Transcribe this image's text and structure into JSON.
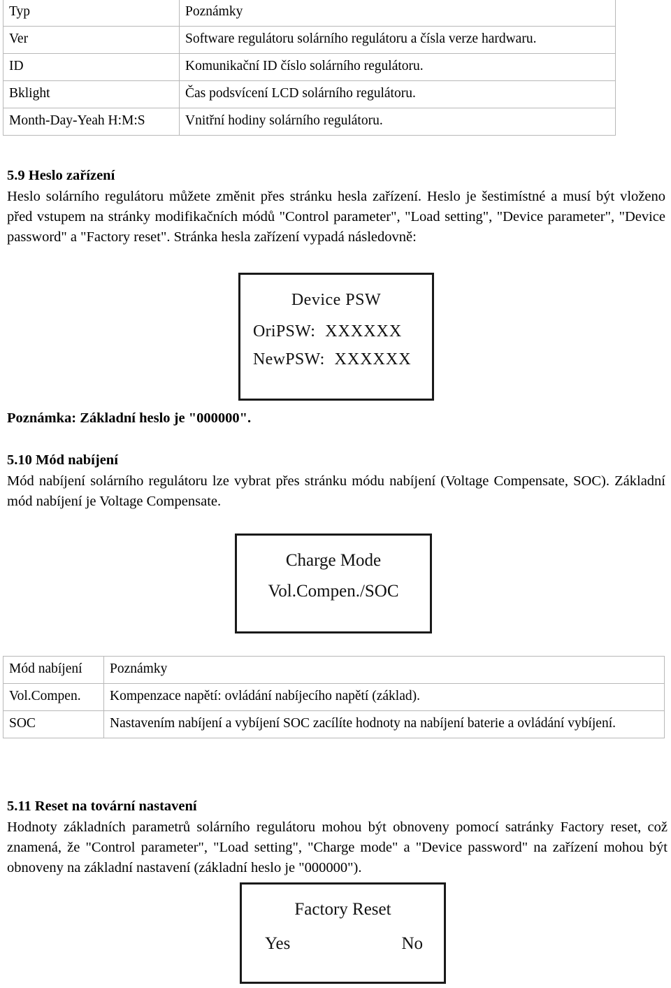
{
  "tables": {
    "type_table": {
      "name": "typ-poznamky-table",
      "headers": [
        "Typ",
        "Poznámky"
      ],
      "rows": [
        [
          "Ver",
          "Software regulátoru solárního regulátoru a čísla verze hardwaru."
        ],
        [
          "ID",
          "Komunikační ID číslo solárního regulátoru."
        ],
        [
          "Bklight",
          "Čas podsvícení LCD solárního regulátoru."
        ],
        [
          "Month-Day-Yeah H:M:S",
          "Vnitřní hodiny solárního regulátoru."
        ]
      ]
    },
    "charge_table": {
      "name": "charge-mode-table",
      "headers": [
        "Mód nabíjení",
        "Poznámky"
      ],
      "rows": [
        [
          "Vol.Compen.",
          "Kompenzace napětí: ovládání nabíjecího napětí (základ)."
        ],
        [
          "SOC",
          "Nastavením nabíjení a vybíjení SOC zacílíte hodnoty na nabíjení baterie a ovládání vybíjení."
        ]
      ]
    }
  },
  "sections": {
    "s59": {
      "heading": "5.9 Heslo zařízení",
      "body": "Heslo solárního regulátoru můžete změnit přes stránku hesla zařízení. Heslo je šestimístné a musí být vloženo před vstupem na stránky modifikačních módů \"Control parameter\", \"Load setting\", \"Device parameter\", \"Device password\" a \"Factory reset\". Stránka hesla zařízení vypadá následovně:"
    },
    "note_psw": "Poznámka: Základní heslo je \"000000\".",
    "s510": {
      "heading": "5.10 Mód nabíjení",
      "body": "Mód nabíjení solárního regulátoru lze vybrat přes stránku módu nabíjení (Voltage Compensate, SOC). Základní mód nabíjení je Voltage Compensate."
    },
    "s511": {
      "heading": "5.11 Reset na tovární nastavení",
      "body": "Hodnoty základních parametrů solárního regulátoru mohou být obnoveny pomocí satránky Factory reset, což znamená, že \"Control parameter\", \"Load setting\", \"Charge mode\" a \"Device password\" na zařízení mohou být obnoveny na základní nastavení (základní heslo je \"000000\")."
    }
  },
  "lcd_screens": {
    "device_psw": {
      "title": "Device PSW",
      "ori_label": "OriPSW:",
      "ori_value": "XXXXXX",
      "new_label": "NewPSW:",
      "new_value": "XXXXXX"
    },
    "charge_mode": {
      "title": "Charge Mode",
      "value": "Vol.Compen./SOC"
    },
    "factory_reset": {
      "title": "Factory Reset",
      "yes": "Yes",
      "no": "No"
    }
  },
  "colors": {
    "text": "#000000",
    "table_border": "#b8b8b8",
    "lcd_border": "#1a1a1a",
    "page_background": "#ffffff"
  }
}
